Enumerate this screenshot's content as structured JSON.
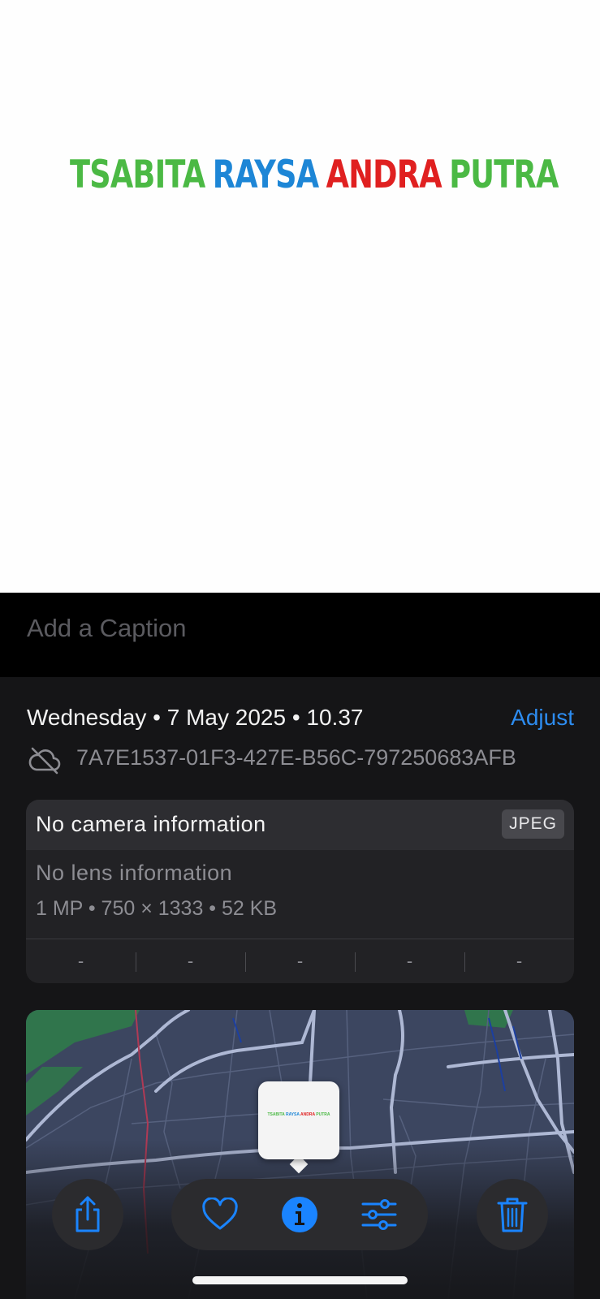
{
  "photo": {
    "words": [
      {
        "text": "TSABITA",
        "color": "#4bb944"
      },
      {
        "text": "RAYSA",
        "color": "#1d86d6"
      },
      {
        "text": "ANDRA",
        "color": "#e02020"
      },
      {
        "text": "PUTRA",
        "color": "#4bb944"
      }
    ]
  },
  "caption": {
    "placeholder": "Add a Caption",
    "value": ""
  },
  "info": {
    "date_line": "Wednesday • 7 May 2025 • 10.37",
    "adjust_label": "Adjust",
    "file_id": "7A7E1537-01F3-427E-B56C-797250683AFB",
    "sync_icon": "cloud-off-icon"
  },
  "camera": {
    "title": "No camera information",
    "format": "JPEG",
    "lens": "No lens information",
    "specs": "1 MP  •  750 × 1333  •  52 KB",
    "exif": [
      "-",
      "-",
      "-",
      "-",
      "-"
    ]
  },
  "map": {
    "thumbnail": "photo-thumbnail"
  },
  "toolbar": {
    "share_icon": "share-icon",
    "favorite_icon": "heart-icon",
    "info_icon": "info-icon",
    "adjust_icon": "sliders-icon",
    "delete_icon": "trash-icon",
    "accent_color": "#1a84ff"
  }
}
